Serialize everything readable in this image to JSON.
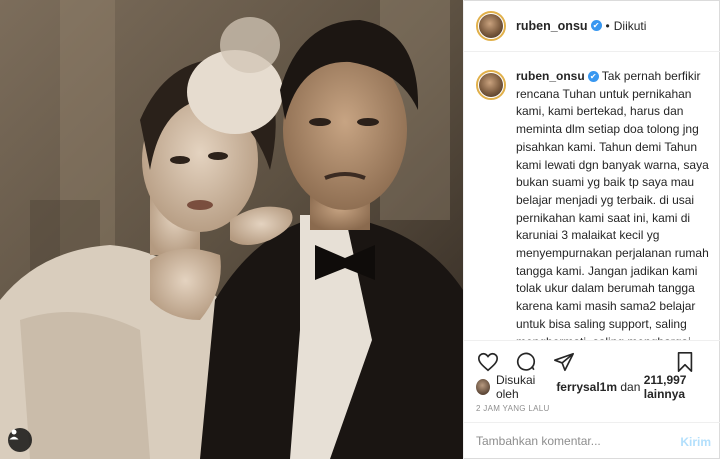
{
  "post": {
    "username": "ruben_onsu",
    "follow_separator": "•",
    "follow_status": "Diikuti",
    "verified_mark": "✔",
    "caption_username": "ruben_onsu",
    "caption": "Tak pernah berfikir rencana Tuhan untuk pernikahan kami, kami bertekad, harus dan meminta dlm setiap doa tolong jng pisahkan kami. Tahun demi Tahun kami lewati dgn banyak warna, saya bukan suami yg baik tp saya mau belajar menjadi yg terbaik. di usai pernikahan kami saat ini, kami di karuniai 3 malaikat kecil yg menyempurnakan perjalanan rumah tangga kami. Jangan jadikan kami tolak ukur dalam berumah tangga karena kami masih sama2 belajar untuk bisa saling support, saling menghormati, saling menghargai, juga menerima segala kekurangan pasangan, dan menghargai perbedaan pendapat lalu disatukan tanpa ada yg",
    "likes_prefix": "Disukai oleh",
    "liked_by": "ferrysal1m",
    "likes_mid": "dan",
    "likes_count": "211,997 lainnya",
    "timestamp": "2 JAM YANG LALU",
    "comment_placeholder": "Tambahkan komentar...",
    "send_label": "Kirim"
  },
  "icons": {
    "like": "heart-icon",
    "comment": "comment-icon",
    "share": "send-icon",
    "save": "bookmark-icon",
    "tag": "user-tag-icon",
    "more": "more-icon"
  },
  "colors": {
    "verified": "#3897f0",
    "send_disabled": "#b2dffc",
    "muted_text": "#8e8e8e",
    "border": "#dbdbdb"
  }
}
